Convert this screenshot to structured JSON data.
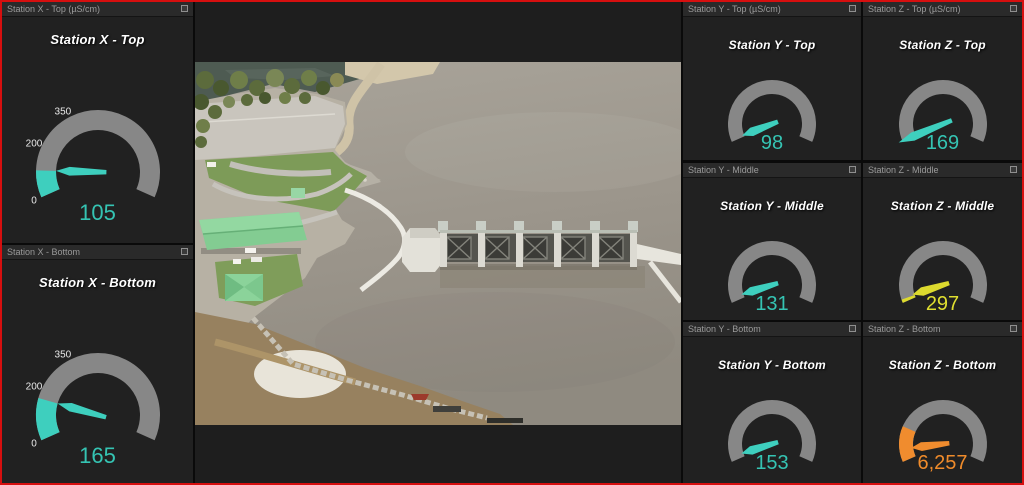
{
  "frame": {
    "border_color": "#d60f0f"
  },
  "panels": [
    {
      "id": "station-x-top",
      "window_title": "Station X - Top (µS/cm)",
      "heading": "Station X - Top",
      "value": "105",
      "value_color": "#35c4b3",
      "gauge": {
        "size": "large",
        "ring_color": "#878787",
        "fill_color": "#3ecfbe",
        "needle_frac": 0.112,
        "fill_frac": 0.112,
        "ticks": [
          {
            "label": "0",
            "frac": 0
          },
          {
            "label": "200",
            "frac": 0.21
          },
          {
            "label": "350",
            "frac": 0.368
          }
        ]
      }
    },
    {
      "id": "station-x-bottom",
      "window_title": "Station X - Bottom",
      "heading": "Station X - Bottom",
      "value": "165",
      "value_color": "#35c4b3",
      "gauge": {
        "size": "large",
        "ring_color": "#878787",
        "fill_color": "#3ecfbe",
        "needle_frac": 0.175,
        "fill_frac": 0.175,
        "ticks": [
          {
            "label": "0",
            "frac": 0
          },
          {
            "label": "200",
            "frac": 0.21
          },
          {
            "label": "350",
            "frac": 0.368
          }
        ]
      }
    },
    {
      "id": "station-y-top",
      "window_title": "Station Y - Top (µS/cm)",
      "heading": "Station Y - Top",
      "value": "98",
      "value_color": "#35c4b3",
      "gauge": {
        "size": "small",
        "ring_color": "#878787",
        "fill_color": "#3ecfbe",
        "needle_frac": 0.012,
        "fill_frac": 0,
        "ticks": []
      }
    },
    {
      "id": "station-z-top",
      "window_title": "Station Z - Top (µS/cm)",
      "heading": "Station Z - Top",
      "value": "169",
      "value_color": "#35c4b3",
      "gauge": {
        "size": "small",
        "ring_color": "#878787",
        "fill_color": "#3ecfbe",
        "needle_frac": 0.006,
        "fill_frac": 0,
        "needle_scale": 1.5,
        "ticks": []
      }
    },
    {
      "id": "station-y-middle",
      "window_title": "Station Y - Middle",
      "heading": "Station Y - Middle",
      "value": "131",
      "value_color": "#35c4b3",
      "gauge": {
        "size": "small",
        "ring_color": "#878787",
        "fill_color": "#3ecfbe",
        "needle_frac": 0.03,
        "fill_frac": 0,
        "ticks": []
      }
    },
    {
      "id": "station-z-middle",
      "window_title": "Station Z - Middle",
      "heading": "Station Z - Middle",
      "value": "297",
      "value_color": "#e0df30",
      "gauge": {
        "size": "small",
        "ring_color": "#878787",
        "fill_color": "#ddda2e",
        "needle_frac": 0.028,
        "fill_frac": 0.02,
        "ticks": []
      }
    },
    {
      "id": "station-y-bottom",
      "window_title": "Station Y - Bottom",
      "heading": "Station Y - Bottom",
      "value": "153",
      "value_color": "#35c4b3",
      "gauge": {
        "size": "small",
        "ring_color": "#878787",
        "fill_color": "#3ecfbe",
        "needle_frac": 0.03,
        "fill_frac": 0,
        "ticks": []
      }
    },
    {
      "id": "station-z-bottom",
      "window_title": "Station Z - Bottom",
      "heading": "Station Z - Bottom",
      "value": "6,257",
      "value_color": "#ef8b2b",
      "gauge": {
        "size": "small",
        "ring_color": "#878787",
        "fill_color": "#f08c2e",
        "needle_frac": 0.075,
        "fill_frac": 0.21,
        "ticks": []
      }
    }
  ]
}
